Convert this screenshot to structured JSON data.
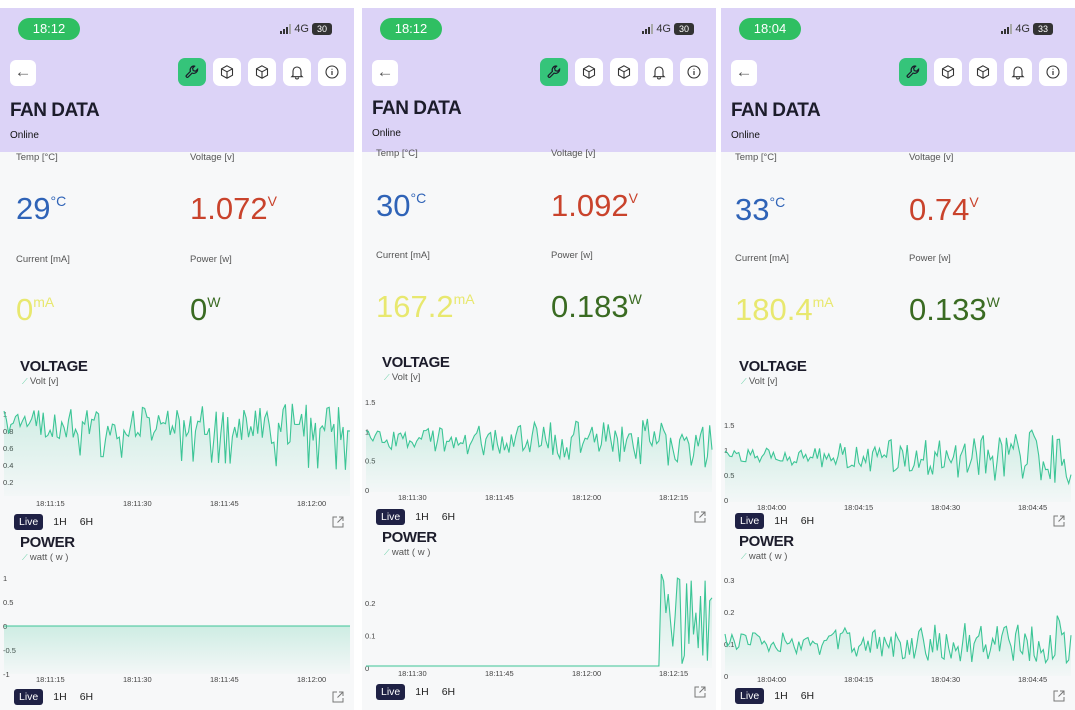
{
  "screens": [
    {
      "status": {
        "time": "18:12",
        "network": "4G",
        "battery": "30"
      },
      "title": "FAN DATA",
      "status_text": "Online",
      "metrics": {
        "temp_label": "Temp [°C]",
        "temp_value": "29",
        "temp_unit": "°C",
        "voltage_label": "Voltage [v]",
        "voltage_value": "1.072",
        "voltage_unit": "V",
        "current_label": "Current [mA]",
        "current_value": "0",
        "current_unit": "mA",
        "power_label": "Power [w]",
        "power_value": "0",
        "power_unit": "W"
      },
      "voltage_chart": {
        "title": "VOLTAGE",
        "legend": "Volt [v]",
        "y_ticks": [
          "1",
          "0.8",
          "0.6",
          "0.4",
          "0.2"
        ],
        "x_ticks": [
          "18:11:15",
          "18:11:30",
          "18:11:45",
          "18:12:00"
        ]
      },
      "power_chart": {
        "title": "POWER",
        "legend": "watt ( w )",
        "y_ticks": [
          "1",
          "0.5",
          "0",
          "-0.5",
          "-1"
        ],
        "x_ticks": [
          "18:11:15",
          "18:11:30",
          "18:11:45",
          "18:12:00"
        ]
      },
      "ranges": {
        "live": "Live",
        "h1": "1H",
        "h6": "6H"
      }
    },
    {
      "status": {
        "time": "18:12",
        "network": "4G",
        "battery": "30"
      },
      "title": "FAN DATA",
      "status_text": "Online",
      "metrics": {
        "temp_label": "Temp [°C]",
        "temp_value": "30",
        "temp_unit": "°C",
        "voltage_label": "Voltage [v]",
        "voltage_value": "1.092",
        "voltage_unit": "V",
        "current_label": "Current [mA]",
        "current_value": "167.2",
        "current_unit": "mA",
        "power_label": "Power [w]",
        "power_value": "0.183",
        "power_unit": "W"
      },
      "voltage_chart": {
        "title": "VOLTAGE",
        "legend": "Volt [v]",
        "y_ticks": [
          "1.5",
          "1",
          "0.5",
          "0"
        ],
        "x_ticks": [
          "18:11:30",
          "18:11:45",
          "18:12:00",
          "18:12:15"
        ]
      },
      "power_chart": {
        "title": "POWER",
        "legend": "watt ( w )",
        "y_ticks": [
          "0.2",
          "0.1",
          "0"
        ],
        "x_ticks": [
          "18:11:30",
          "18:11:45",
          "18:12:00",
          "18:12:15"
        ]
      },
      "ranges": {
        "live": "Live",
        "h1": "1H",
        "h6": "6H"
      }
    },
    {
      "status": {
        "time": "18:04",
        "network": "4G",
        "battery": "33"
      },
      "title": "FAN DATA",
      "status_text": "Online",
      "metrics": {
        "temp_label": "Temp [°C]",
        "temp_value": "33",
        "temp_unit": "°C",
        "voltage_label": "Voltage [v]",
        "voltage_value": "0.74",
        "voltage_unit": "V",
        "current_label": "Current [mA]",
        "current_value": "180.4",
        "current_unit": "mA",
        "power_label": "Power [w]",
        "power_value": "0.133",
        "power_unit": "W"
      },
      "voltage_chart": {
        "title": "VOLTAGE",
        "legend": "Volt [v]",
        "y_ticks": [
          "1.5",
          "1",
          "0.5",
          "0"
        ],
        "x_ticks": [
          "18:04:00",
          "18:04:15",
          "18:04:30",
          "18:04:45"
        ]
      },
      "power_chart": {
        "title": "POWER",
        "legend": "watt ( w )",
        "y_ticks": [
          "0.3",
          "0.2",
          "0.1",
          "0"
        ],
        "x_ticks": [
          "18:04:00",
          "18:04:15",
          "18:04:30",
          "18:04:45"
        ]
      },
      "ranges": {
        "live": "Live",
        "h1": "1H",
        "h6": "6H"
      }
    }
  ],
  "icons": [
    "back-arrow-icon",
    "wrench-icon",
    "cube-icon",
    "cube-icon",
    "bell-icon",
    "info-icon",
    "expand-icon"
  ],
  "colors": {
    "header": "#dcd3f7",
    "accent": "#35c47a",
    "line": "#3cc596",
    "temp": "#2f63b7",
    "voltage": "#c9432c",
    "current": "#e8e86f",
    "power": "#3a6b22",
    "live_pill": "#1f2145"
  }
}
